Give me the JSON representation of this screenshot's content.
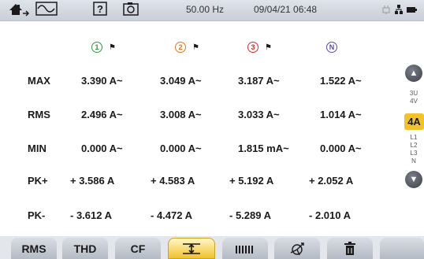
{
  "status_bar": {
    "frequency": "50.00 Hz",
    "datetime": "09/04/21 06:48"
  },
  "channels": [
    {
      "id": "1",
      "color": "#2e9b3a"
    },
    {
      "id": "2",
      "color": "#e8731d"
    },
    {
      "id": "3",
      "color": "#d42a2a"
    },
    {
      "id": "N",
      "color": "#5a4aa8"
    }
  ],
  "rows": [
    {
      "label": "MAX",
      "values": [
        "3.390 A~",
        "3.049 A~",
        "3.187 A~",
        "1.522 A~"
      ]
    },
    {
      "label": "RMS",
      "values": [
        "2.496 A~",
        "3.008 A~",
        "3.033 A~",
        "1.014 A~"
      ]
    },
    {
      "label": "MIN",
      "values": [
        "0.000 A~",
        "0.000 A~",
        "1.815 mA~",
        "0.000 A~"
      ]
    },
    {
      "label": "PK+",
      "values": [
        "+ 3.586 A",
        "+ 4.583 A",
        "+ 5.192 A",
        "+ 2.052 A"
      ]
    },
    {
      "label": "PK-",
      "values": [
        "- 3.612 A",
        "- 4.472 A",
        "- 5.289 A",
        "- 2.010 A"
      ]
    }
  ],
  "side_panel": {
    "items_top": [
      "3U",
      "4V"
    ],
    "selected": "4A",
    "items_bottom": [
      "L1",
      "L2",
      "L3",
      "N"
    ]
  },
  "tabs": [
    {
      "label": "RMS"
    },
    {
      "label": "THD"
    },
    {
      "label": "CF"
    },
    {
      "label": "",
      "icon": "min-max-icon",
      "active": true
    },
    {
      "label": "",
      "icon": "bars-icon"
    },
    {
      "label": "",
      "icon": "phasor-icon"
    },
    {
      "label": "",
      "icon": "trash-icon"
    },
    {
      "label": ""
    }
  ],
  "colors": {
    "accent": "#f2c22c",
    "bar": "#c9ced7"
  }
}
